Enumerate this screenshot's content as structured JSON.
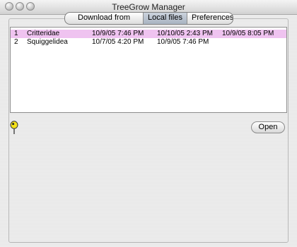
{
  "window": {
    "title": "TreeGrow Manager"
  },
  "tabs": [
    {
      "label": "Download from server",
      "selected": false
    },
    {
      "label": "Local files",
      "selected": true
    },
    {
      "label": "Preferences",
      "selected": false
    }
  ],
  "files": {
    "rows": [
      {
        "index": "1",
        "name": "Critteridae",
        "date1": "10/9/05 7:46 PM",
        "date2": "10/10/05 2:43 PM",
        "date3": "10/9/05 8:05 PM",
        "selected": true
      },
      {
        "index": "2",
        "name": "Squiggelidea",
        "date1": "10/7/05 4:20 PM",
        "date2": "10/9/05 7:46 PM",
        "date3": "",
        "selected": false
      }
    ]
  },
  "actions": {
    "open_label": "Open"
  },
  "colors": {
    "selection": "#efc3f0",
    "tab_selected": "#b8c1cd",
    "icon_yellow": "#f4e11a"
  },
  "icons": {
    "status": "pushpin-icon"
  }
}
